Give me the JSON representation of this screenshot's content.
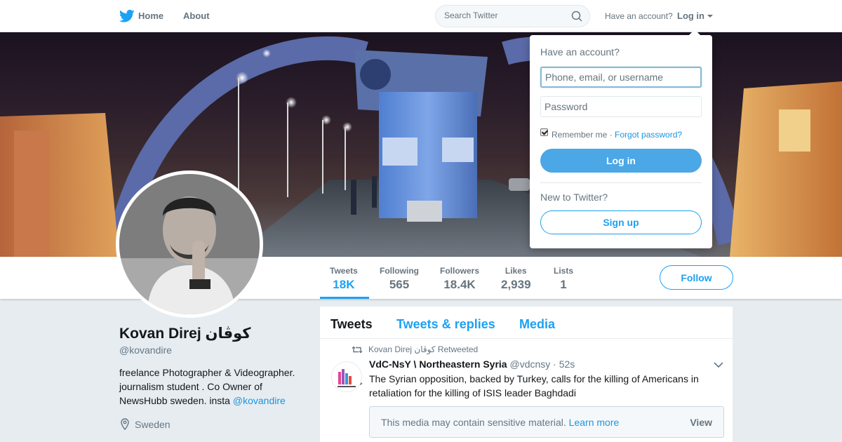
{
  "nav": {
    "home_label": "Home",
    "about_label": "About",
    "search_placeholder": "Search Twitter",
    "have_account": "Have an account?",
    "login_label": "Log in",
    "brand_color": "#1da1f2"
  },
  "stats": [
    {
      "label": "Tweets",
      "value": "18K",
      "active": true
    },
    {
      "label": "Following",
      "value": "565"
    },
    {
      "label": "Followers",
      "value": "18.4K"
    },
    {
      "label": "Likes",
      "value": "2,939"
    },
    {
      "label": "Lists",
      "value": "1"
    }
  ],
  "follow_label": "Follow",
  "profile": {
    "name": "Kovan Direj کوڤان",
    "handle": "@kovandire",
    "bio_text": "freelance Photographer & Videographer. journalism student . Co Owner of NewsHubb sweden. insta ",
    "bio_link": "@kovandire",
    "location": "Sweden"
  },
  "timeline": {
    "tabs": [
      "Tweets",
      "Tweets & replies",
      "Media"
    ],
    "retweet_context": "Kovan Direj کوڤان Retweeted",
    "tweet": {
      "name": "VdC-NsY \\ Northeastern Syria",
      "handle": "@vdcnsy",
      "time": "· 52s",
      "text": "The Syrian opposition, backed by Turkey, calls for the killing of Americans in retaliation for the killing of ISIS leader Baghdadi",
      "sensitive_text": "This media may contain sensitive material.",
      "sensitive_link": "Learn more",
      "view_label": "View"
    }
  },
  "login_dropdown": {
    "title": "Have an account?",
    "username_placeholder": "Phone, email, or username",
    "password_placeholder": "Password",
    "remember_label": "Remember me",
    "separator": " · ",
    "forgot_label": "Forgot password?",
    "login_button": "Log in",
    "new_label": "New to Twitter?",
    "signup_button": "Sign up"
  }
}
